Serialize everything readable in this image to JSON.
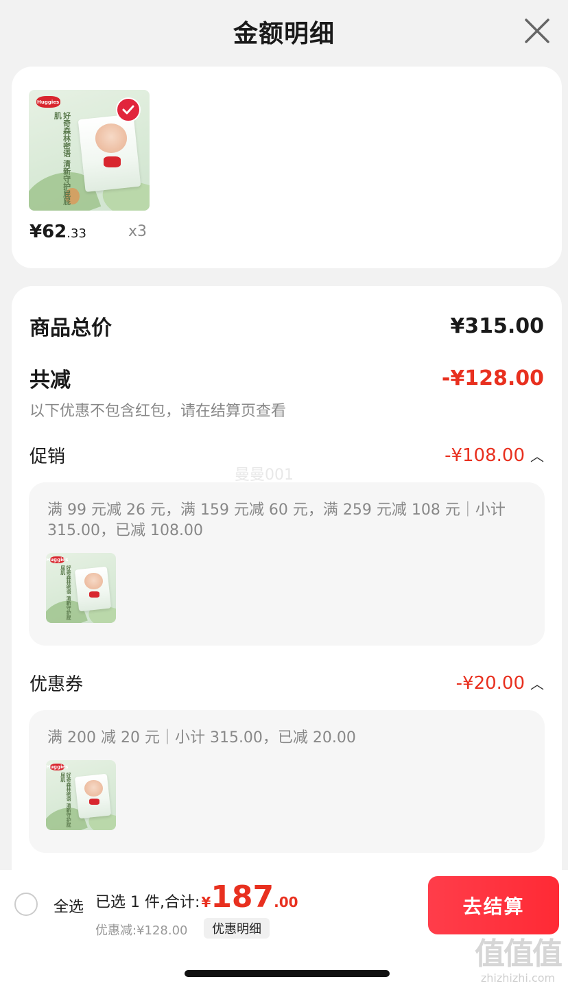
{
  "header": {
    "title": "金额明细"
  },
  "product": {
    "thumb_logo": "Huggies",
    "thumb_text": "好奇森林密语 清新守护屁屁肌",
    "price_yen": "¥",
    "price_int": "62",
    "price_dec": ".33",
    "qty": "x3"
  },
  "details": {
    "total_label": "商品总价",
    "total_amount": "¥315.00",
    "reduce_label": "共减",
    "reduce_amount": "-¥128.00",
    "note": "以下优惠不包含红包，请在结算页查看",
    "watermark": "曼曼001",
    "promo": {
      "label": "促销",
      "amount": "-¥108.00",
      "rule": "满 99 元减 26 元，满 159 元减 60 元，满 259 元减 108 元｜小计 315.00，已减 108.00"
    },
    "coupon": {
      "label": "优惠券",
      "amount": "-¥20.00",
      "rule": "满 200 减 20 元｜小计 315.00，已减 20.00"
    }
  },
  "bottom": {
    "select_all": "全选",
    "selected_text": "已选 1 件,合计:",
    "total_yen": "¥",
    "total_int": "187",
    "total_dec": ".00",
    "discount_text": "优惠减:¥128.00",
    "detail_chip": "优惠明细",
    "checkout": "去结算"
  },
  "site": {
    "logo": "值值值",
    "url": "zhizhizhi.com"
  },
  "colors": {
    "accent_red": "#e8301f",
    "button_red": "#ff2a35",
    "badge_red": "#e1253c"
  }
}
